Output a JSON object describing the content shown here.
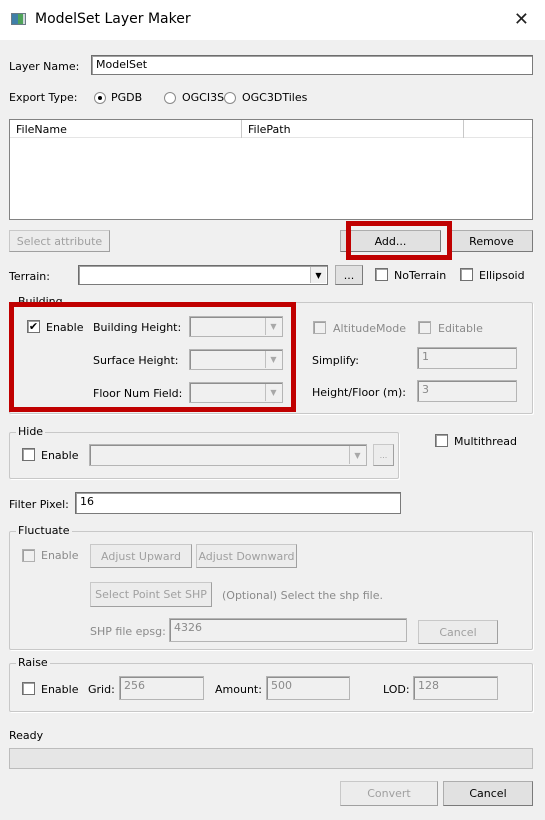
{
  "window": {
    "title": "ModelSet Layer Maker",
    "close_icon": "close-icon"
  },
  "layer_name": {
    "label": "Layer Name:",
    "value": "ModelSet"
  },
  "export_type": {
    "label": "Export Type:",
    "options": [
      {
        "label": "PGDB",
        "selected": true
      },
      {
        "label": "OGCI3S",
        "selected": false
      },
      {
        "label": "OGC3DTiles",
        "selected": false
      }
    ]
  },
  "file_list": {
    "columns": [
      "FileName",
      "FilePath",
      ""
    ],
    "rows": []
  },
  "buttons": {
    "select_attribute": "Select attribute",
    "add": "Add...",
    "remove": "Remove",
    "convert": "Convert",
    "cancel": "Cancel"
  },
  "terrain": {
    "label": "Terrain:",
    "value": "",
    "browse": "...",
    "no_terrain": {
      "label": "NoTerrain",
      "checked": false
    },
    "ellipsoid": {
      "label": "Ellipsoid",
      "checked": false
    }
  },
  "building": {
    "title": "Building",
    "enable": {
      "label": "Enable",
      "checked": true
    },
    "building_height_label": "Building Height:",
    "surface_height_label": "Surface Height:",
    "floor_num_field_label": "Floor Num Field:",
    "altitude_mode": {
      "label": "AltitudeMode",
      "checked": false
    },
    "editable": {
      "label": "Editable",
      "checked": false
    },
    "simplify_label": "Simplify:",
    "simplify_value": "1",
    "height_floor_label": "Height/Floor (m):",
    "height_floor_value": "3"
  },
  "hide": {
    "title": "Hide",
    "enable": {
      "label": "Enable",
      "checked": false
    },
    "browse": "..."
  },
  "multithread": {
    "label": "Multithread",
    "checked": false
  },
  "filter_pixel": {
    "label": "Filter Pixel:",
    "value": "16"
  },
  "fluctuate": {
    "title": "Fluctuate",
    "enable": {
      "label": "Enable",
      "checked": false
    },
    "adjust_upward": "Adjust Upward",
    "adjust_downward": "Adjust Downward",
    "select_point_set": "Select Point Set SHP",
    "hint": "(Optional) Select the shp file.",
    "epsg_label": "SHP file epsg:",
    "epsg_value": "4326",
    "cancel": "Cancel"
  },
  "raise": {
    "title": "Raise",
    "enable": {
      "label": "Enable",
      "checked": false
    },
    "grid_label": "Grid:",
    "grid_value": "256",
    "amount_label": "Amount:",
    "amount_value": "500",
    "lod_label": "LOD:",
    "lod_value": "128"
  },
  "status": {
    "text": "Ready",
    "progress": 0
  },
  "annotations": {
    "highlight_color": "#c00000"
  }
}
